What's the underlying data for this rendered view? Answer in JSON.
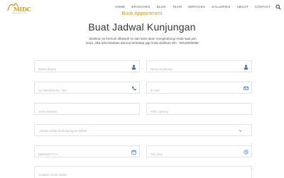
{
  "header": {
    "logo_text": "MIDC",
    "logo_subtext": "Mitra Insani Dental Clinic",
    "nav": [
      "HOME",
      "BRANCHES",
      "BLOG",
      "TEAM",
      "SERVICES",
      "GALLERIES",
      "ABOUT",
      "CONTACT"
    ]
  },
  "page": {
    "section_label": "Book Appointment",
    "title": "Buat Jadwal Kunjungan",
    "intro": "Silahkan isi formulir dibawah ini dan kami akan menghubungi Anda saat jam kerja. Jika ada keadaan darurat terhadap gigi Anda silahkan WA : 08118838388."
  },
  "form": {
    "name_placeholder": "Nama depan",
    "lastname_placeholder": "Nama belakang",
    "phone_placeholder": "No Handphone / WA",
    "email_placeholder": "E-mail",
    "gender_placeholder": "Jenis kelamin",
    "branch_placeholder": "Pilih Cabang",
    "reason_placeholder": "Alasan untuk berkunjung ke dokter",
    "date_placeholder": "MM/DD/YYYY",
    "time_placeholder": "Any time",
    "notes_placeholder": "Catatan untuk dokter"
  },
  "colors": {
    "accent": "#d4a017",
    "icon": "#3a6fb8"
  }
}
